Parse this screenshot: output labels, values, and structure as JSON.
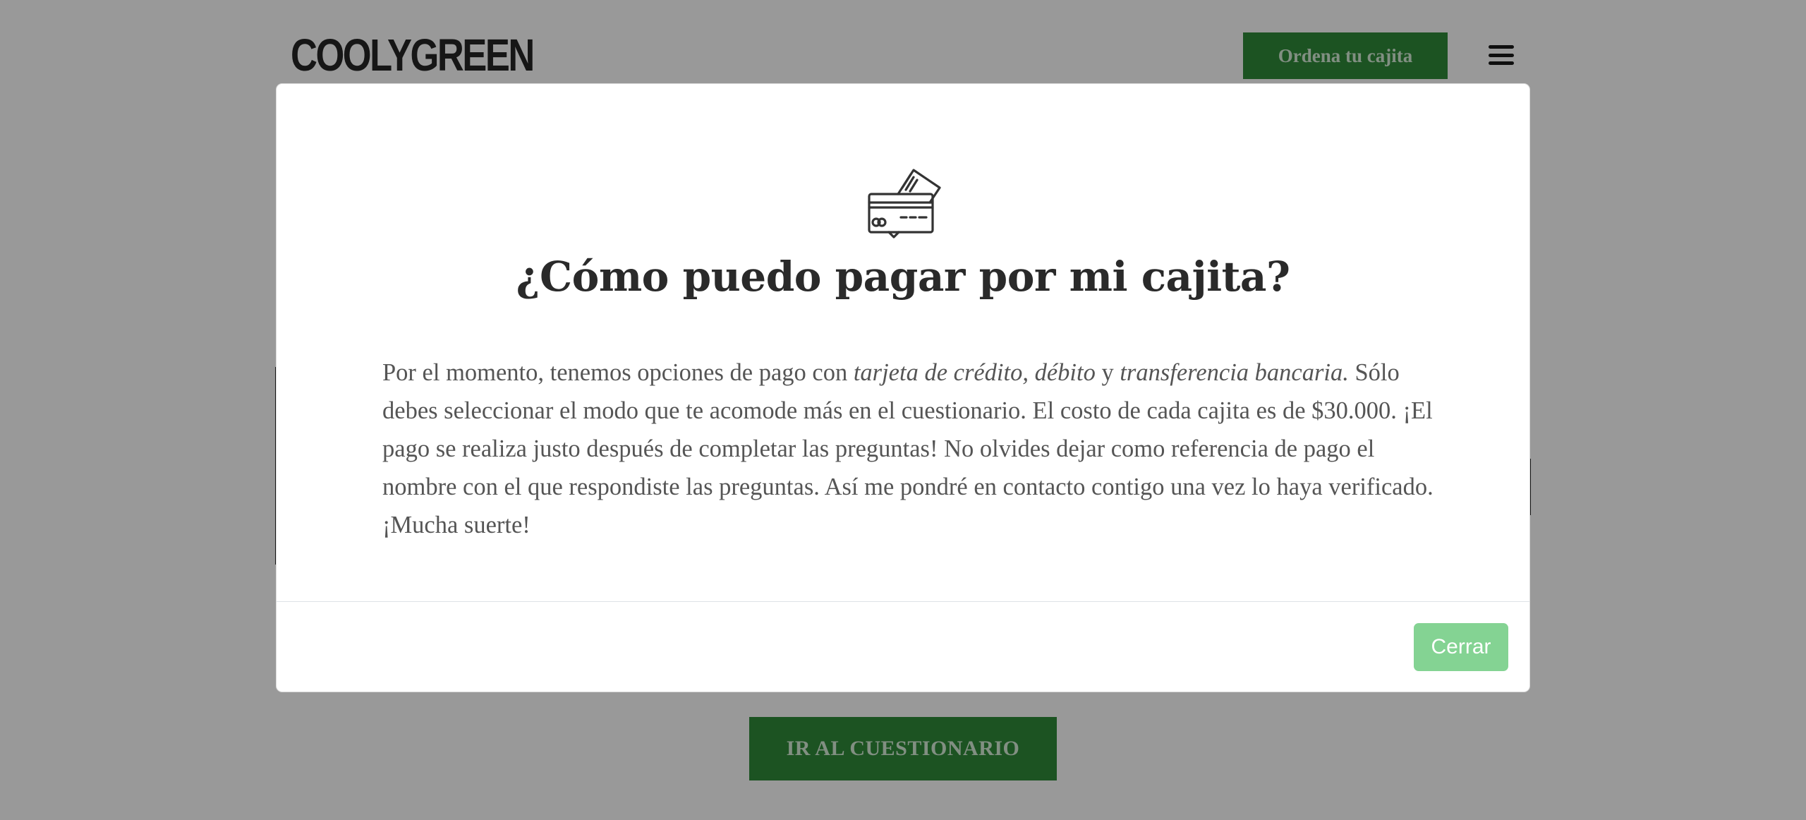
{
  "header": {
    "logo_text": "COOLYGREEN",
    "order_button_label": "Ordena tu cajita",
    "menu_icon": "hamburger-menu-icon"
  },
  "main": {
    "quiz_button_label": "IR AL CUESTIONARIO"
  },
  "modal": {
    "icon": "credit-card-icon",
    "title": "¿Cómo puedo pagar por mi cajita?",
    "body": {
      "part1": "Por el momento, tenemos opciones de pago con ",
      "em1": "tarjeta de crédito, débito",
      "part2": " y ",
      "em2": "transferencia bancaria.",
      "part3": " Sólo debes seleccionar el modo que te acomode más en el cuestionario. El costo de cada cajita es de $30.000. ¡El pago se realiza justo después de completar las preguntas! No olvides dejar como referencia de pago el nombre con el que respondiste las preguntas. Así me pondré en contacto contigo una vez lo haya verificado. ¡Mucha suerte!"
    },
    "close_label": "Cerrar"
  },
  "colors": {
    "brand_green": "#2f8a3a",
    "close_button_green": "#84d393",
    "title_text": "#2a2a2a",
    "body_text": "#555555",
    "backdrop": "rgba(0,0,0,0.4)"
  }
}
